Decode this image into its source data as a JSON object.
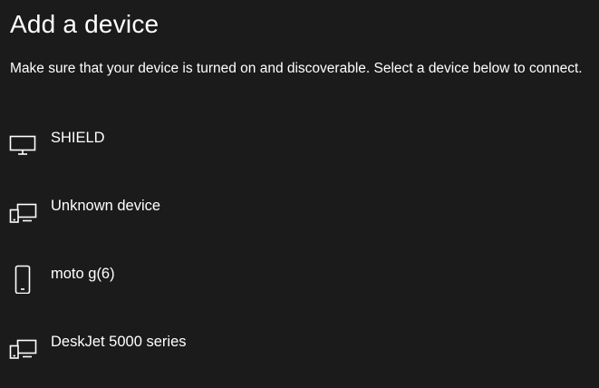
{
  "page": {
    "title": "Add a device",
    "instructions": "Make sure that your device is turned on and discoverable. Select a device below to connect."
  },
  "devices": [
    {
      "label": "SHIELD",
      "icon": "monitor-icon"
    },
    {
      "label": "Unknown device",
      "icon": "devices-icon"
    },
    {
      "label": "moto g(6)",
      "icon": "phone-icon"
    },
    {
      "label": "DeskJet 5000 series",
      "icon": "devices-icon"
    }
  ],
  "colors": {
    "background": "#1b1b1b",
    "text": "#ffffff"
  }
}
